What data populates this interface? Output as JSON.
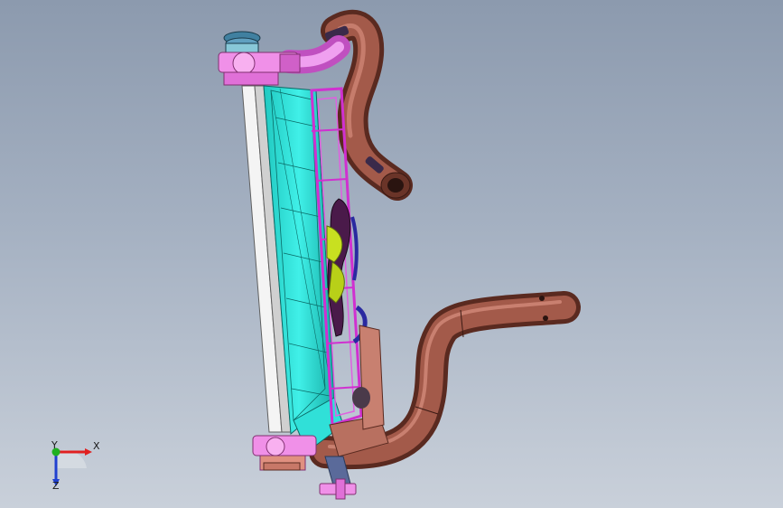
{
  "viewport": {
    "background_top": "#8c9aae",
    "background_bottom": "#c9d0da"
  },
  "triad": {
    "x_label": "X",
    "y_label": "Y",
    "z_label": "Z",
    "x_color": "#e02020",
    "y_color": "#20b020",
    "z_color": "#2040d0"
  },
  "model": {
    "colors": {
      "radiator_frame": "#f5f5f5",
      "fan_shroud": "#2ee0d8",
      "bracket": "#e040e0",
      "hose": "#8a4a3a",
      "upper_hose_end": "#e070e0",
      "highlight": "#c8e020",
      "clip": "#2a2aa0"
    }
  }
}
